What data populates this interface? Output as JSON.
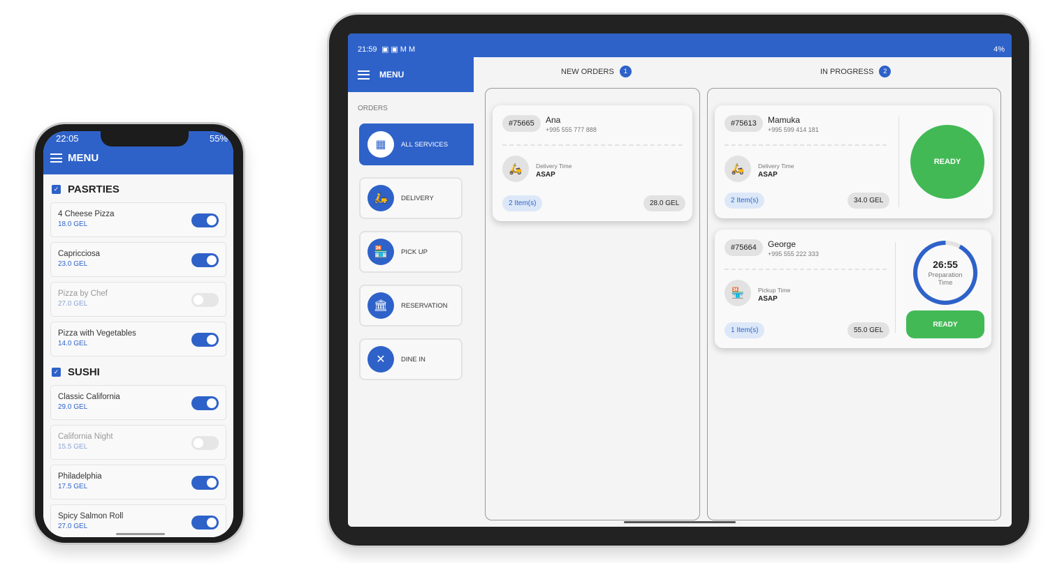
{
  "phone": {
    "status": {
      "time": "22:05",
      "battery": "55%"
    },
    "header": "MENU",
    "categories": [
      {
        "name": "PASRTIES",
        "items": [
          {
            "name": "4 Cheese Pizza",
            "price": "18.0 GEL",
            "enabled": true
          },
          {
            "name": "Capricciosa",
            "price": "23.0 GEL",
            "enabled": true
          },
          {
            "name": "Pizza by Chef",
            "price": "27.0 GEL",
            "enabled": false
          },
          {
            "name": "Pizza with Vegetables",
            "price": "14.0 GEL",
            "enabled": true
          }
        ]
      },
      {
        "name": "SUSHI",
        "items": [
          {
            "name": "Classic California",
            "price": "29.0 GEL",
            "enabled": true
          },
          {
            "name": "California Night",
            "price": "15.5 GEL",
            "enabled": false
          },
          {
            "name": "Philadelphia",
            "price": "17.5 GEL",
            "enabled": true
          },
          {
            "name": "Spicy Salmon Roll",
            "price": "27.0 GEL",
            "enabled": true
          }
        ]
      }
    ]
  },
  "tablet": {
    "status": {
      "time": "21:59",
      "battery": "4%"
    },
    "header": "MENU",
    "section": "ORDERS",
    "services": [
      {
        "label": "ALL SERVICES",
        "icon": "grid-icon",
        "active": true
      },
      {
        "label": "DELIVERY",
        "icon": "scooter-icon"
      },
      {
        "label": "PICK UP",
        "icon": "pickup-icon"
      },
      {
        "label": "RESERVATION",
        "icon": "reservation-icon"
      },
      {
        "label": "DINE IN",
        "icon": "cutlery-icon"
      }
    ],
    "columns": [
      {
        "title": "NEW ORDERS",
        "count": "1"
      },
      {
        "title": "IN PROGRESS",
        "count": "2"
      }
    ],
    "new_orders": [
      {
        "id": "#75665",
        "name": "Ana",
        "phone": "+995 555 777 888",
        "time_label": "Delivery Time",
        "time": "ASAP",
        "items": "2 Item(s)",
        "price": "28.0 GEL"
      }
    ],
    "in_progress": [
      {
        "id": "#75613",
        "name": "Mamuka",
        "phone": "+995 599 414 181",
        "time_label": "Delivery Time",
        "time": "ASAP",
        "items": "2 Item(s)",
        "price": "34.0 GEL",
        "action": "READY"
      },
      {
        "id": "#75664",
        "name": "George",
        "phone": "+995 555 222 333",
        "time_label": "Pickup Time",
        "time": "ASAP",
        "items": "1 Item(s)",
        "price": "55.0 GEL",
        "timer": "26:55",
        "timer_label": "Preparation Time",
        "timer_progress": 0.92,
        "action": "READY"
      }
    ]
  },
  "colors": {
    "primary": "#2e62c9",
    "success": "#43b956"
  }
}
